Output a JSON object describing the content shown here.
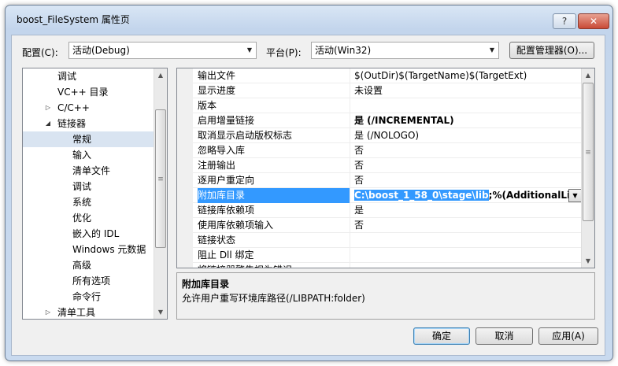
{
  "window": {
    "title": "boost_FileSystem 属性页"
  },
  "titlebar": {
    "help_label": "?",
    "close_label": "✕"
  },
  "config": {
    "label": "配置(C):",
    "value": "活动(Debug)"
  },
  "platform": {
    "label": "平台(P):",
    "value": "活动(Win32)"
  },
  "config_manager_label": "配置管理器(O)...",
  "tree": {
    "items": [
      {
        "label": "调试",
        "level": 1,
        "expander": ""
      },
      {
        "label": "VC++ 目录",
        "level": 1,
        "expander": ""
      },
      {
        "label": "C/C++",
        "level": 1,
        "expander": "▷"
      },
      {
        "label": "链接器",
        "level": 1,
        "expander": "◢"
      },
      {
        "label": "常规",
        "level": 2,
        "expander": "",
        "selected": true
      },
      {
        "label": "输入",
        "level": 2,
        "expander": ""
      },
      {
        "label": "清单文件",
        "level": 2,
        "expander": ""
      },
      {
        "label": "调试",
        "level": 2,
        "expander": ""
      },
      {
        "label": "系统",
        "level": 2,
        "expander": ""
      },
      {
        "label": "优化",
        "level": 2,
        "expander": ""
      },
      {
        "label": "嵌入的 IDL",
        "level": 2,
        "expander": ""
      },
      {
        "label": "Windows 元数据",
        "level": 2,
        "expander": ""
      },
      {
        "label": "高级",
        "level": 2,
        "expander": ""
      },
      {
        "label": "所有选项",
        "level": 2,
        "expander": ""
      },
      {
        "label": "命令行",
        "level": 2,
        "expander": ""
      },
      {
        "label": "清单工具",
        "level": 1,
        "expander": "▷"
      }
    ]
  },
  "properties": [
    {
      "name": "输出文件",
      "value": "$(OutDir)$(TargetName)$(TargetExt)",
      "bold": false
    },
    {
      "name": "显示进度",
      "value": "未设置",
      "bold": false
    },
    {
      "name": "版本",
      "value": "",
      "bold": false
    },
    {
      "name": "启用增量链接",
      "value": "是 (/INCREMENTAL)",
      "bold": true
    },
    {
      "name": "取消显示启动版权标志",
      "value": "是 (/NOLOGO)",
      "bold": false
    },
    {
      "name": "忽略导入库",
      "value": "否",
      "bold": false
    },
    {
      "name": "注册输出",
      "value": "否",
      "bold": false
    },
    {
      "name": "逐用户重定向",
      "value": "否",
      "bold": false
    },
    {
      "name": "附加库目录",
      "value_highlighted": "C:\\boost_1_58_0\\stage\\lib",
      "value_rest": ";%(AdditionalLibra",
      "selected": true
    },
    {
      "name": "链接库依赖项",
      "value": "是",
      "bold": false
    },
    {
      "name": "使用库依赖项输入",
      "value": "否",
      "bold": false
    },
    {
      "name": "链接状态",
      "value": "",
      "bold": false
    },
    {
      "name": "阻止 Dll 绑定",
      "value": "",
      "bold": false
    },
    {
      "name": "将链接器警告视为错误",
      "value": "",
      "bold": false
    }
  ],
  "description": {
    "title": "附加库目录",
    "text": "允许用户重写环境库路径(/LIBPATH:folder)"
  },
  "buttons": {
    "ok": "确定",
    "cancel": "取消",
    "apply": "应用(A)"
  },
  "icons": {
    "scroll_up": "▲",
    "scroll_down": "▼",
    "thumb_grip": "≡",
    "dropdown": "▼"
  }
}
